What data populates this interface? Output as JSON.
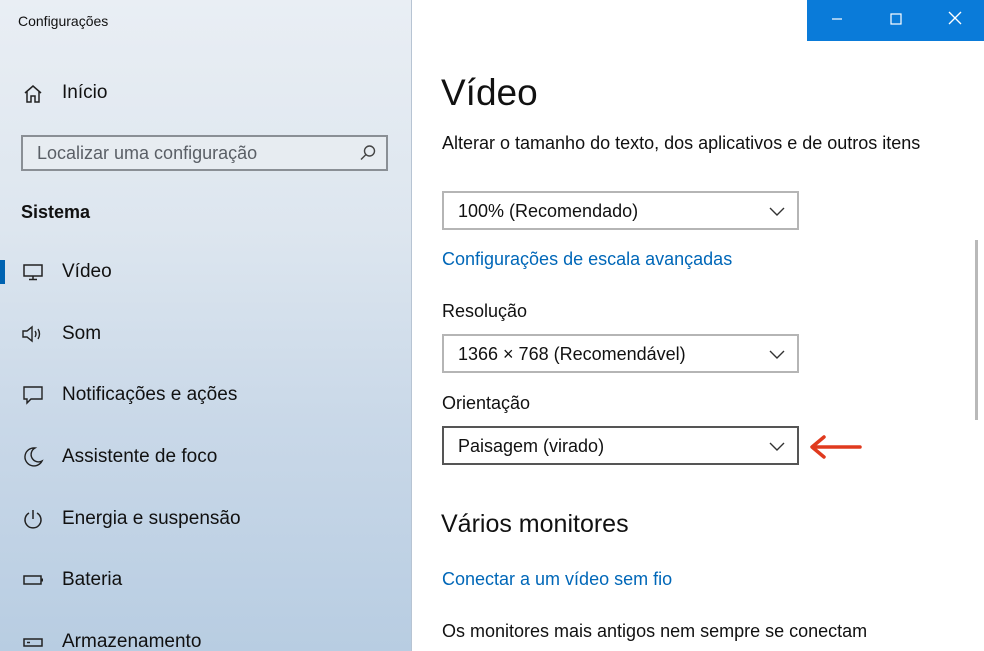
{
  "window": {
    "app_title": "Configurações"
  },
  "sidebar": {
    "home_label": "Início",
    "search_placeholder": "Localizar uma configuração",
    "section_title": "Sistema",
    "items": [
      {
        "label": "Vídeo",
        "icon": "monitor-icon",
        "selected": true
      },
      {
        "label": "Som",
        "icon": "speaker-icon"
      },
      {
        "label": "Notificações e ações",
        "icon": "notification-icon"
      },
      {
        "label": "Assistente de foco",
        "icon": "moon-icon"
      },
      {
        "label": "Energia e suspensão",
        "icon": "power-icon"
      },
      {
        "label": "Bateria",
        "icon": "battery-icon"
      },
      {
        "label": "Armazenamento",
        "icon": "storage-icon"
      }
    ]
  },
  "titlebar": {
    "buttons": [
      "minimize-icon",
      "maximize-icon",
      "close-icon"
    ]
  },
  "main": {
    "title": "Vídeo",
    "scale_description": "Alterar o tamanho do texto, dos aplicativos e de outros itens",
    "scale_value": "100% (Recomendado)",
    "advanced_scaling_link": "Configurações de escala avançadas",
    "resolution_label": "Resolução",
    "resolution_value": "1366 × 768 (Recomendável)",
    "orientation_label": "Orientação",
    "orientation_value": "Paisagem (virado)",
    "multi_monitors_heading": "Vários monitores",
    "wireless_link": "Conectar a um vídeo sem fio",
    "older_monitors_text": "Os monitores mais antigos nem sempre se conectam"
  },
  "colors": {
    "accent": "#0063b1",
    "link": "#0067b8",
    "titlebar_blue": "#0a7bd9",
    "annotation_arrow": "#e03a1e"
  }
}
